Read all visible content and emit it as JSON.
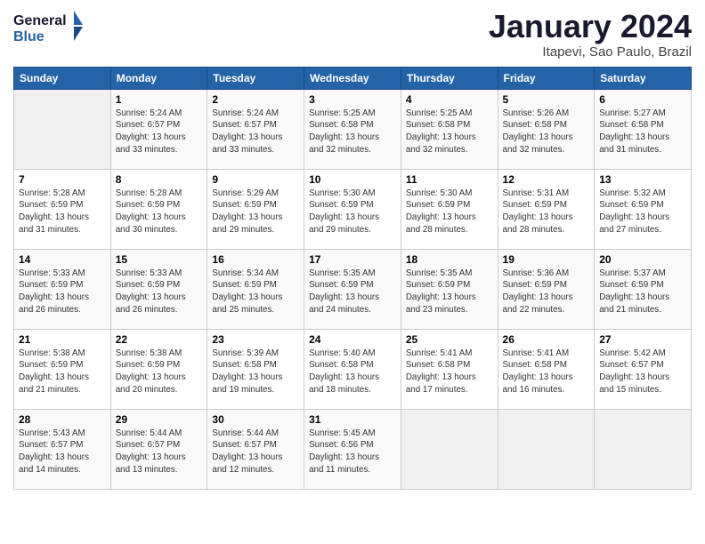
{
  "header": {
    "logo_line1": "General",
    "logo_line2": "Blue",
    "month_year": "January 2024",
    "location": "Itapevi, Sao Paulo, Brazil"
  },
  "weekdays": [
    "Sunday",
    "Monday",
    "Tuesday",
    "Wednesday",
    "Thursday",
    "Friday",
    "Saturday"
  ],
  "weeks": [
    [
      {
        "day": "",
        "sunrise": "",
        "sunset": "",
        "daylight": ""
      },
      {
        "day": "1",
        "sunrise": "5:24 AM",
        "sunset": "6:57 PM",
        "daylight": "13 hours and 33 minutes."
      },
      {
        "day": "2",
        "sunrise": "5:24 AM",
        "sunset": "6:57 PM",
        "daylight": "13 hours and 33 minutes."
      },
      {
        "day": "3",
        "sunrise": "5:25 AM",
        "sunset": "6:58 PM",
        "daylight": "13 hours and 32 minutes."
      },
      {
        "day": "4",
        "sunrise": "5:25 AM",
        "sunset": "6:58 PM",
        "daylight": "13 hours and 32 minutes."
      },
      {
        "day": "5",
        "sunrise": "5:26 AM",
        "sunset": "6:58 PM",
        "daylight": "13 hours and 32 minutes."
      },
      {
        "day": "6",
        "sunrise": "5:27 AM",
        "sunset": "6:58 PM",
        "daylight": "13 hours and 31 minutes."
      }
    ],
    [
      {
        "day": "7",
        "sunrise": "5:28 AM",
        "sunset": "6:59 PM",
        "daylight": "13 hours and 31 minutes."
      },
      {
        "day": "8",
        "sunrise": "5:28 AM",
        "sunset": "6:59 PM",
        "daylight": "13 hours and 30 minutes."
      },
      {
        "day": "9",
        "sunrise": "5:29 AM",
        "sunset": "6:59 PM",
        "daylight": "13 hours and 29 minutes."
      },
      {
        "day": "10",
        "sunrise": "5:30 AM",
        "sunset": "6:59 PM",
        "daylight": "13 hours and 29 minutes."
      },
      {
        "day": "11",
        "sunrise": "5:30 AM",
        "sunset": "6:59 PM",
        "daylight": "13 hours and 28 minutes."
      },
      {
        "day": "12",
        "sunrise": "5:31 AM",
        "sunset": "6:59 PM",
        "daylight": "13 hours and 28 minutes."
      },
      {
        "day": "13",
        "sunrise": "5:32 AM",
        "sunset": "6:59 PM",
        "daylight": "13 hours and 27 minutes."
      }
    ],
    [
      {
        "day": "14",
        "sunrise": "5:33 AM",
        "sunset": "6:59 PM",
        "daylight": "13 hours and 26 minutes."
      },
      {
        "day": "15",
        "sunrise": "5:33 AM",
        "sunset": "6:59 PM",
        "daylight": "13 hours and 26 minutes."
      },
      {
        "day": "16",
        "sunrise": "5:34 AM",
        "sunset": "6:59 PM",
        "daylight": "13 hours and 25 minutes."
      },
      {
        "day": "17",
        "sunrise": "5:35 AM",
        "sunset": "6:59 PM",
        "daylight": "13 hours and 24 minutes."
      },
      {
        "day": "18",
        "sunrise": "5:35 AM",
        "sunset": "6:59 PM",
        "daylight": "13 hours and 23 minutes."
      },
      {
        "day": "19",
        "sunrise": "5:36 AM",
        "sunset": "6:59 PM",
        "daylight": "13 hours and 22 minutes."
      },
      {
        "day": "20",
        "sunrise": "5:37 AM",
        "sunset": "6:59 PM",
        "daylight": "13 hours and 21 minutes."
      }
    ],
    [
      {
        "day": "21",
        "sunrise": "5:38 AM",
        "sunset": "6:59 PM",
        "daylight": "13 hours and 21 minutes."
      },
      {
        "day": "22",
        "sunrise": "5:38 AM",
        "sunset": "6:59 PM",
        "daylight": "13 hours and 20 minutes."
      },
      {
        "day": "23",
        "sunrise": "5:39 AM",
        "sunset": "6:58 PM",
        "daylight": "13 hours and 19 minutes."
      },
      {
        "day": "24",
        "sunrise": "5:40 AM",
        "sunset": "6:58 PM",
        "daylight": "13 hours and 18 minutes."
      },
      {
        "day": "25",
        "sunrise": "5:41 AM",
        "sunset": "6:58 PM",
        "daylight": "13 hours and 17 minutes."
      },
      {
        "day": "26",
        "sunrise": "5:41 AM",
        "sunset": "6:58 PM",
        "daylight": "13 hours and 16 minutes."
      },
      {
        "day": "27",
        "sunrise": "5:42 AM",
        "sunset": "6:57 PM",
        "daylight": "13 hours and 15 minutes."
      }
    ],
    [
      {
        "day": "28",
        "sunrise": "5:43 AM",
        "sunset": "6:57 PM",
        "daylight": "13 hours and 14 minutes."
      },
      {
        "day": "29",
        "sunrise": "5:44 AM",
        "sunset": "6:57 PM",
        "daylight": "13 hours and 13 minutes."
      },
      {
        "day": "30",
        "sunrise": "5:44 AM",
        "sunset": "6:57 PM",
        "daylight": "13 hours and 12 minutes."
      },
      {
        "day": "31",
        "sunrise": "5:45 AM",
        "sunset": "6:56 PM",
        "daylight": "13 hours and 11 minutes."
      },
      {
        "day": "",
        "sunrise": "",
        "sunset": "",
        "daylight": ""
      },
      {
        "day": "",
        "sunrise": "",
        "sunset": "",
        "daylight": ""
      },
      {
        "day": "",
        "sunrise": "",
        "sunset": "",
        "daylight": ""
      }
    ]
  ]
}
